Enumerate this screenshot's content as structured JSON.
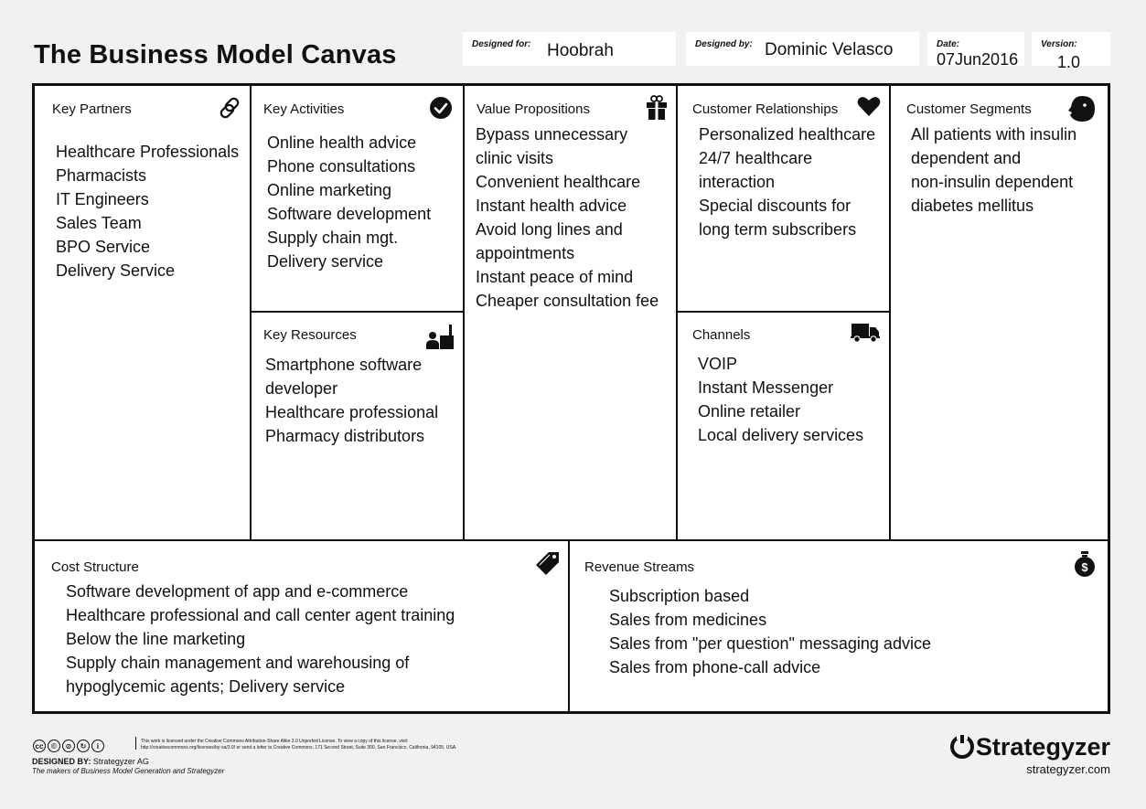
{
  "header": {
    "title": "The Business Model Canvas",
    "designed_for_label": "Designed for:",
    "designed_for": "Hoobrah",
    "designed_by_label": "Designed by:",
    "designed_by": "Dominic Velasco",
    "date_label": "Date:",
    "date": "07Jun2016",
    "version_label": "Version:",
    "version": "1.0"
  },
  "key_partners": {
    "title": "Key Partners",
    "icon": "link-icon",
    "items": [
      "Healthcare Professionals",
      "Pharmacists",
      "IT Engineers",
      "Sales Team",
      "BPO Service",
      "Delivery Service"
    ]
  },
  "key_activities": {
    "title": "Key Activities",
    "icon": "checkmark-icon",
    "items": [
      "Online health advice",
      "Phone consultations",
      "Online marketing",
      "Software development",
      "Supply chain mgt.",
      "Delivery service"
    ]
  },
  "key_resources": {
    "title": "Key Resources",
    "icon": "factory-worker-icon",
    "items": [
      "Smartphone software",
      "developer",
      "Healthcare professional",
      "Pharmacy distributors"
    ]
  },
  "value_propositions": {
    "title": "Value Propositions",
    "icon": "gift-icon",
    "items": [
      "Bypass unnecessary",
      "clinic visits",
      "Convenient healthcare",
      "Instant health advice",
      "Avoid long lines and",
      "appointments",
      "Instant peace of mind",
      "Cheaper consultation fee"
    ]
  },
  "customer_relationships": {
    "title": "Customer Relationships",
    "icon": "heart-icon",
    "items": [
      "Personalized healthcare",
      "24/7 healthcare",
      "interaction",
      "Special discounts for",
      "long term subscribers"
    ]
  },
  "channels": {
    "title": "Channels",
    "icon": "truck-icon",
    "items": [
      "VOIP",
      "Instant Messenger",
      "Online retailer",
      "Local delivery services"
    ]
  },
  "customer_segments": {
    "title": "Customer Segments",
    "icon": "face-icon",
    "items": [
      "All patients with insulin",
      "dependent and",
      "non-insulin dependent",
      "diabetes mellitus"
    ]
  },
  "cost_structure": {
    "title": "Cost Structure",
    "icon": "price-tag-icon",
    "items": [
      "Software development of app and e-commerce",
      "Healthcare professional and call center agent training",
      "Below the line marketing",
      "Supply chain management and warehousing of",
      "hypoglycemic agents; Delivery service"
    ]
  },
  "revenue_streams": {
    "title": "Revenue Streams",
    "icon": "money-bag-icon",
    "items": [
      "Subscription based",
      "Sales from medicines",
      "Sales from \"per question\" messaging advice",
      "Sales from phone-call advice"
    ]
  },
  "footer": {
    "license_line1": "This work is licensed under the Creative Commons Attribution-Share Alike 3.0 Unported License. To view a copy of this license, visit:",
    "license_line2": "http://creativecommons.org/licenses/by-sa/3.0/ or send a letter to Creative Commons, 171 Second Street, Suite 300, San Francisco, California, 94105, USA.",
    "designed_by_label": "DESIGNED BY:",
    "designed_by": "Strategyzer AG",
    "tagline": "The makers of Business Model Generation and Strategyzer",
    "brand": "Strategyzer",
    "brand_url": "strategyzer.com"
  }
}
